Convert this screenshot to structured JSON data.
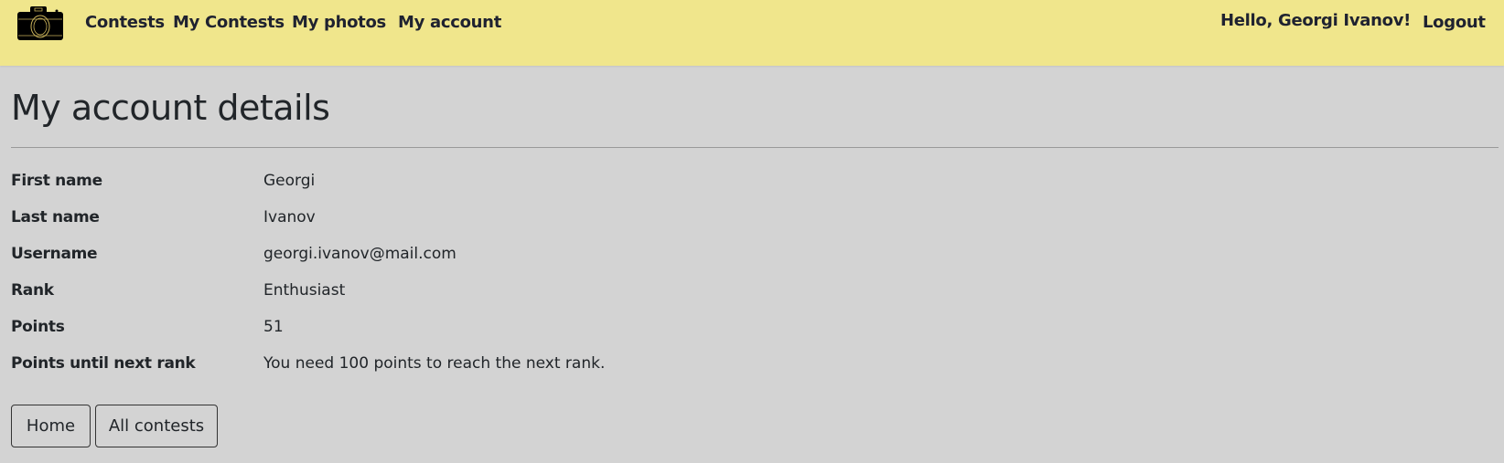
{
  "nav": {
    "links": [
      "Contests",
      "My Contests",
      "My photos",
      "My account"
    ],
    "greeting": "Hello, Georgi Ivanov!",
    "logout": "Logout"
  },
  "page": {
    "title": "My account details"
  },
  "details": [
    {
      "label": "First name",
      "value": "Georgi"
    },
    {
      "label": "Last name",
      "value": "Ivanov"
    },
    {
      "label": "Username",
      "value": "georgi.ivanov@mail.com"
    },
    {
      "label": "Rank",
      "value": "Enthusiast"
    },
    {
      "label": "Points",
      "value": "51"
    },
    {
      "label": "Points until next rank",
      "value": "You need 100 points to reach the next rank."
    }
  ],
  "buttons": {
    "home": "Home",
    "all_contests": "All contests"
  },
  "colors": {
    "navbar": "#f0e68c",
    "background": "#d3d3d3"
  }
}
